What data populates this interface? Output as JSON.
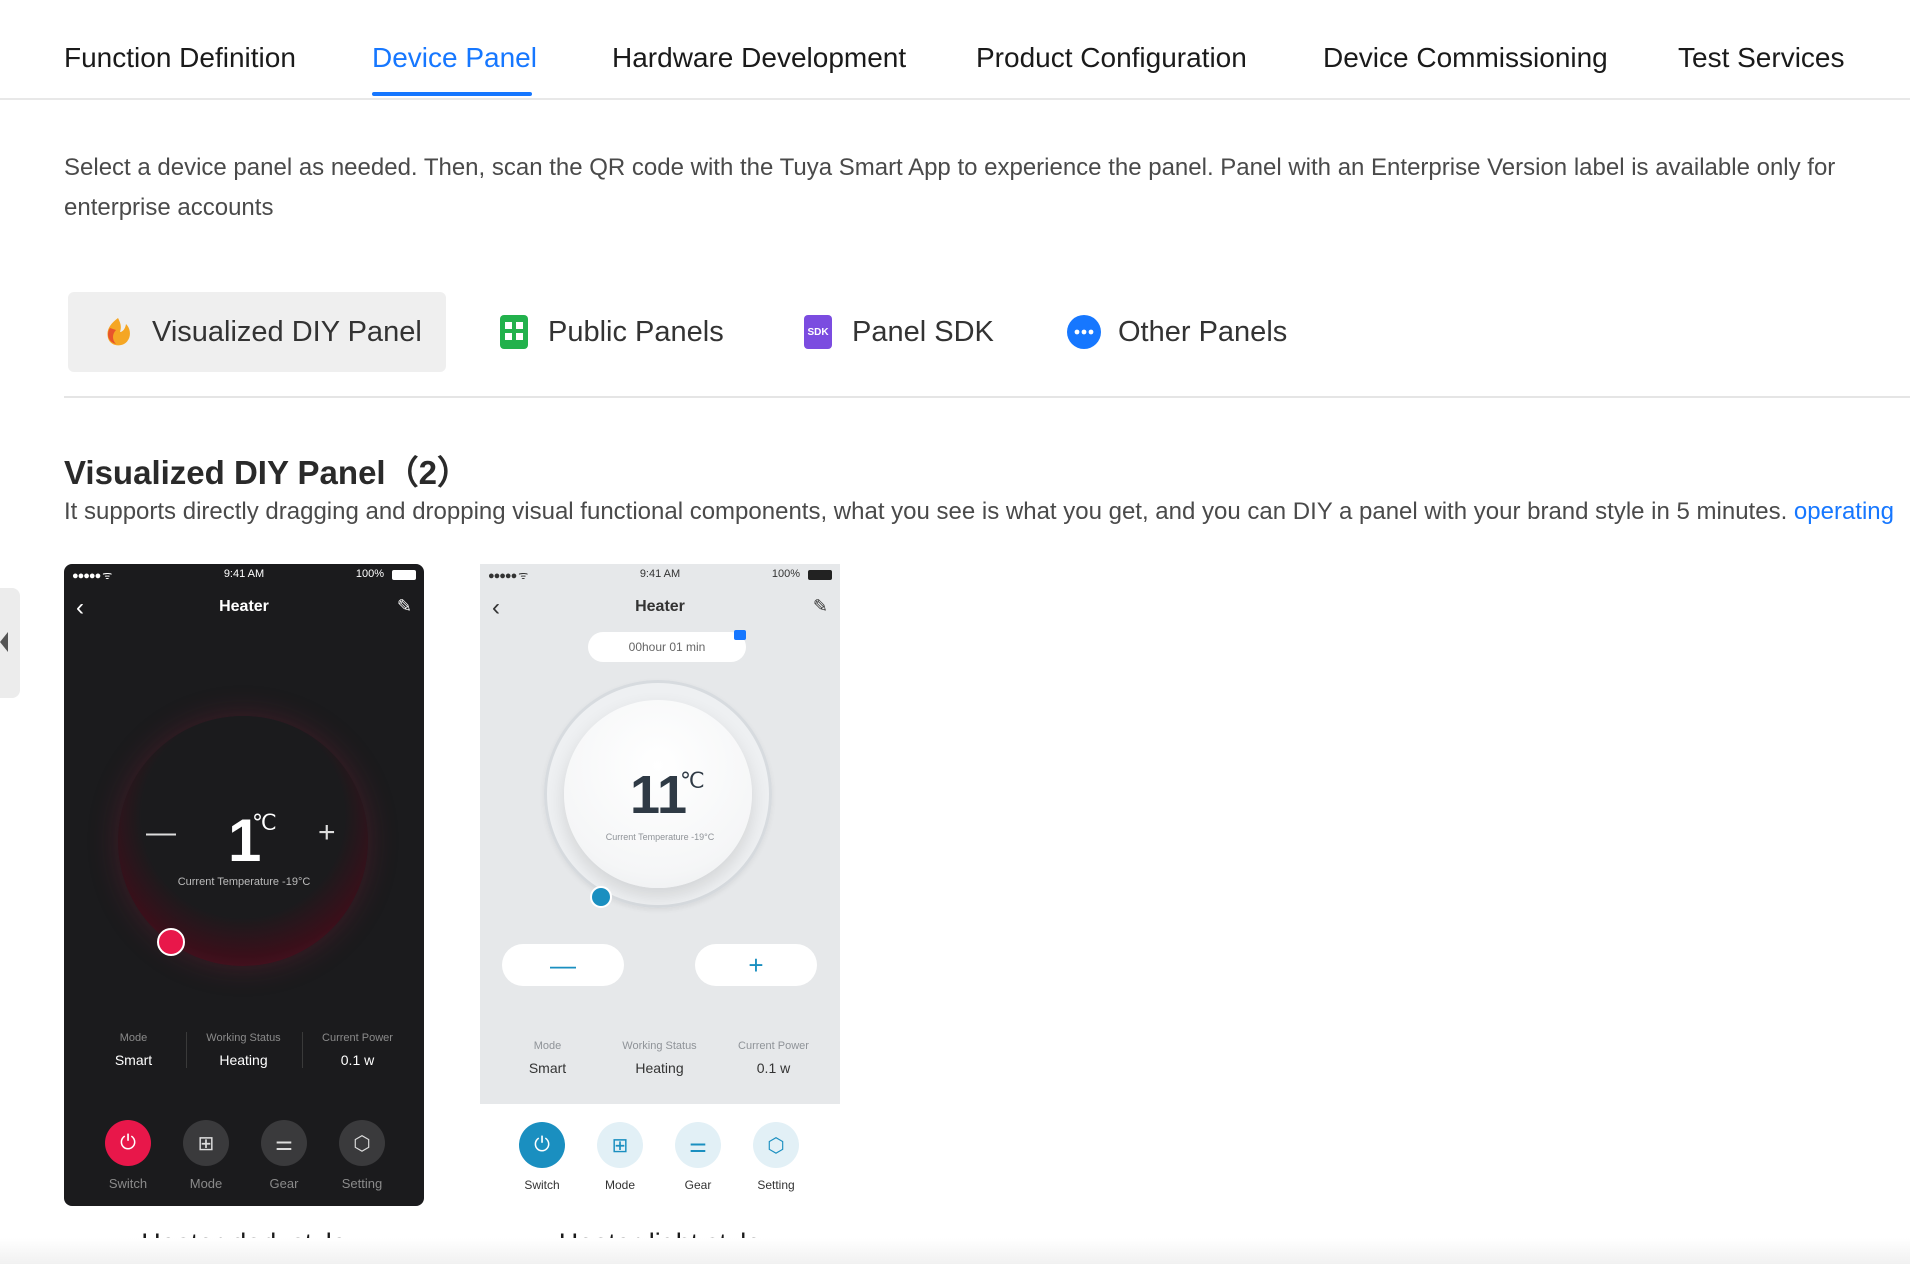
{
  "topnav": {
    "tabs": [
      {
        "label": "Function Definition"
      },
      {
        "label": "Device Panel",
        "active": true
      },
      {
        "label": "Hardware Development"
      },
      {
        "label": "Product Configuration"
      },
      {
        "label": "Device Commissioning"
      },
      {
        "label": "Test Services"
      }
    ]
  },
  "intro": "Select a device panel as needed. Then, scan the QR code with the Tuya Smart App to experience the panel. Panel with an Enterprise Version label is available only for enterprise accounts",
  "category_tabs": [
    {
      "label": "Visualized DIY Panel",
      "icon": "diy-panel-icon",
      "active": true
    },
    {
      "label": "Public Panels",
      "icon": "public-panels-icon"
    },
    {
      "label": "Panel SDK",
      "icon": "sdk-icon",
      "icon_text": "SDK"
    },
    {
      "label": "Other Panels",
      "icon": "more-dots-icon"
    }
  ],
  "section": {
    "title": "Visualized DIY Panel（2）",
    "description": "It supports directly dragging and dropping visual functional components, what you see is what you get, and you can DIY a panel with your brand style in 5 minutes. ",
    "link": "operating"
  },
  "panels": [
    {
      "caption": "Heater-dark style",
      "status": {
        "signal": "●●●●● ᯤ",
        "time": "9:41 AM",
        "battery": "100%"
      },
      "title": "Heater",
      "temperature": "1",
      "unit": "℃",
      "current_temp": "Current Temperature -19°C",
      "minus": "—",
      "plus": "+",
      "stats": [
        {
          "label": "Mode",
          "value": "Smart"
        },
        {
          "label": "Working Status",
          "value": "Heating"
        },
        {
          "label": "Current Power",
          "value": "0.1 w"
        }
      ],
      "buttons": [
        {
          "label": "Switch",
          "icon": "power-icon"
        },
        {
          "label": "Mode",
          "icon": "grid-icon"
        },
        {
          "label": "Gear",
          "icon": "sliders-icon"
        },
        {
          "label": "Setting",
          "icon": "hexagon-settings-icon"
        }
      ],
      "accent": "#e8174a"
    },
    {
      "caption": "Heater-light style",
      "status": {
        "signal": "●●●●● ᯤ",
        "time": "9:41 AM",
        "battery": "100%"
      },
      "title": "Heater",
      "timer": "00hour 01 min",
      "temperature": "11",
      "unit": "℃",
      "current_temp": "Current Temperature -19°C",
      "minus": "—",
      "plus": "+",
      "stats": [
        {
          "label": "Mode",
          "value": "Smart"
        },
        {
          "label": "Working Status",
          "value": "Heating"
        },
        {
          "label": "Current Power",
          "value": "0.1 w"
        }
      ],
      "buttons": [
        {
          "label": "Switch",
          "icon": "power-icon"
        },
        {
          "label": "Mode",
          "icon": "grid-icon"
        },
        {
          "label": "Gear",
          "icon": "sliders-icon"
        },
        {
          "label": "Setting",
          "icon": "hexagon-settings-icon"
        }
      ],
      "accent": "#1a8fc0"
    }
  ],
  "colors": {
    "primary": "#1677ff",
    "dark_accent": "#e8174a",
    "light_accent": "#1a8fc0"
  }
}
